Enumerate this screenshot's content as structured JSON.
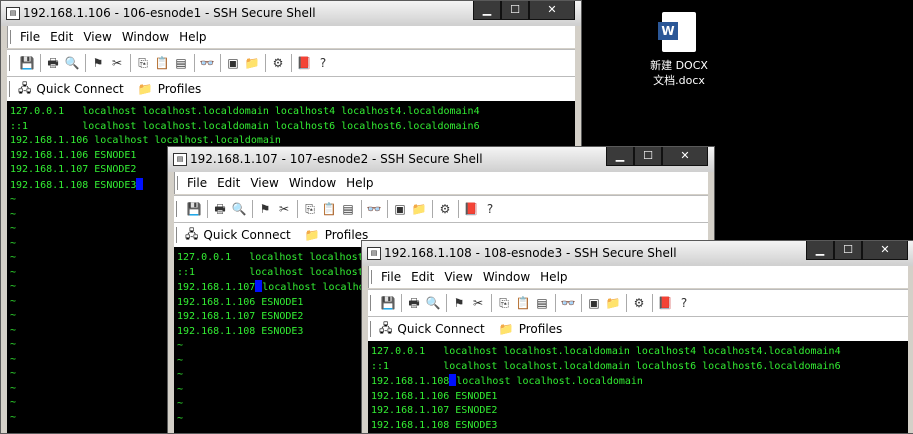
{
  "desktop": {
    "icon_label_line1": "新建 DOCX",
    "icon_label_line2": "文档.docx",
    "icon": "word-doc-icon"
  },
  "menu": [
    "File",
    "Edit",
    "View",
    "Window",
    "Help"
  ],
  "quickbar": {
    "quick_connect": "Quick Connect",
    "profiles": "Profiles"
  },
  "window_buttons": {
    "minimize": "▁",
    "maximize": "☐",
    "close": "✕"
  },
  "windows": [
    {
      "title": "192.168.1.106 - 106-esnode1 - SSH Secure Shell",
      "lines": [
        "127.0.0.1   localhost localhost.localdomain localhost4 localhost4.localdomain4",
        "::1         localhost localhost.localdomain localhost6 localhost6.localdomain6",
        "192.168.1.106 localhost localhost.localdomain",
        "192.168.1.106 ESNODE1",
        "192.168.1.107 ESNODE2",
        "192.168.1.108 ESNODE3"
      ],
      "tilde": "~"
    },
    {
      "title": "192.168.1.107 - 107-esnode2 - SSH Secure Shell",
      "lines": [
        "127.0.0.1   localhost localhost.localdomain localhost4 localhost4.localdomain4",
        "::1         localhost localhost.localdomain localhost6 localhost6.localdomain6",
        "192.168.1.107 localhost localhost.localdomain",
        "192.168.1.106 ESNODE1",
        "192.168.1.107 ESNODE2",
        "192.168.1.108 ESNODE3"
      ],
      "tilde": "~"
    },
    {
      "title": "192.168.1.108 - 108-esnode3 - SSH Secure Shell",
      "lines": [
        "127.0.0.1   localhost localhost.localdomain localhost4 localhost4.localdomain4",
        "::1         localhost localhost.localdomain localhost6 localhost6.localdomain6",
        "192.168.1.108 localhost localhost.localdomain",
        "192.168.1.106 ESNODE1",
        "192.168.1.107 ESNODE2",
        "192.168.1.108 ESNODE3"
      ],
      "tilde": "~"
    }
  ]
}
